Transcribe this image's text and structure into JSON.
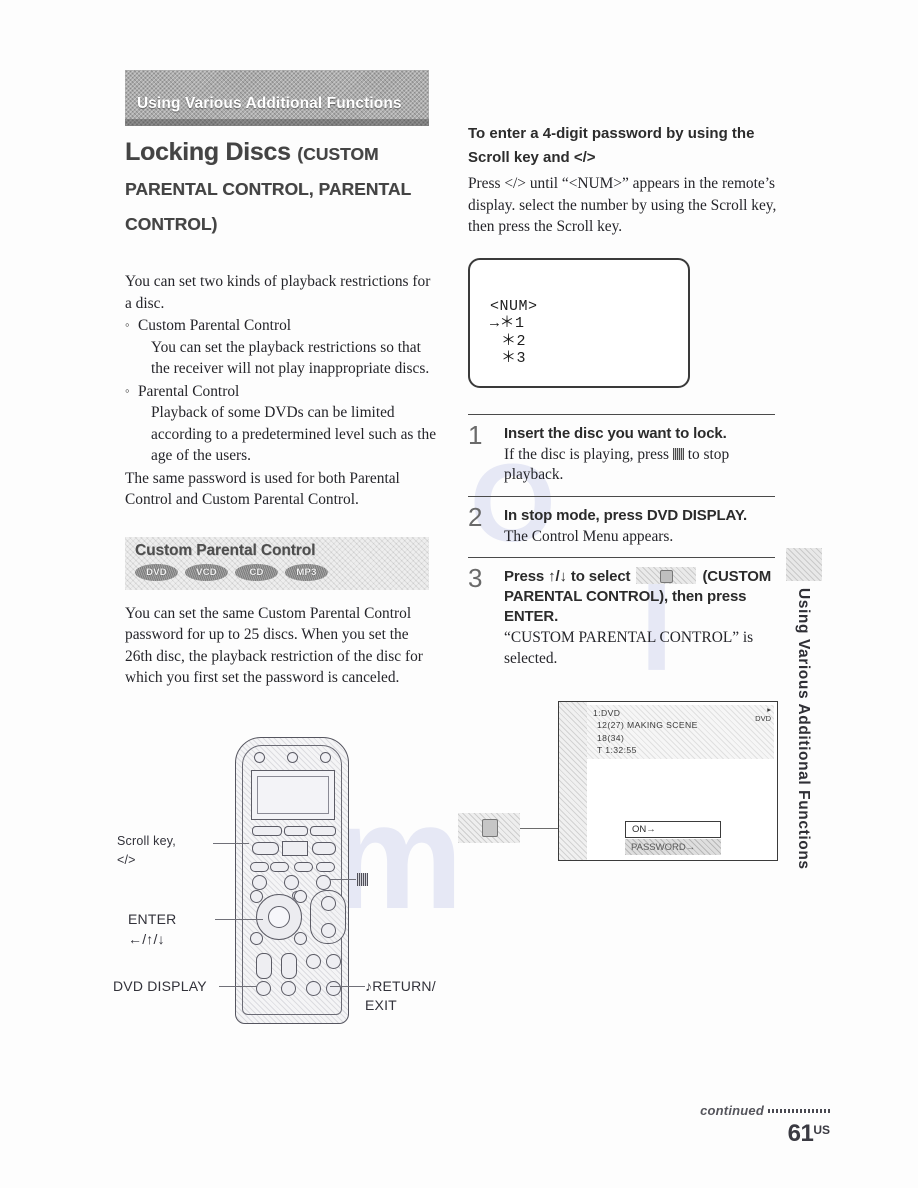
{
  "chapter": {
    "band_label": "Using Various Additional Functions"
  },
  "title": {
    "main": "Locking Discs",
    "paren": "(CUSTOM PARENTAL CONTROL, PARENTAL CONTROL)"
  },
  "left_column": {
    "intro": "You can set two kinds of playback restrictions for a disc.",
    "bullets": [
      {
        "label": "Custom Parental Control",
        "desc": "You can set the playback restrictions so that the receiver will not play inappropriate discs."
      },
      {
        "label": "Parental Control",
        "desc": "Playback of some DVDs can be limited according to a predetermined level such as the age of the users."
      }
    ],
    "closing": "The same password is used for both Parental Control and Custom Parental Control.",
    "subsection": {
      "title": "Custom Parental Control",
      "badges": [
        "DVD",
        "VCD",
        "CD",
        "MP3"
      ]
    },
    "subsection_body": "You can set the same Custom Parental Control password for up to 25 discs. When you set the 26th disc, the playback restriction of the disc for which you first set the password is canceled."
  },
  "remote_figure": {
    "labels": {
      "scroll_key": "Scroll key,",
      "scroll_key_sub": "</>",
      "enter": "ENTER",
      "enter_sub": "←/↑/↓",
      "dvd_display": "DVD DISPLAY",
      "return_exit": "♪RETURN/",
      "return_exit_sub": "EXIT"
    }
  },
  "right_column": {
    "heading": "To enter a 4-digit password by using the Scroll key and </>",
    "heading_body": "Press </> until “<NUM>” appears in the remote’s display. select the number by using the Scroll key, then press the Scroll key.",
    "display_box": {
      "line1": "<NUM>",
      "line2": "→＊1",
      "line3": "＊2",
      "line4": "＊3"
    },
    "steps": [
      {
        "num": "1",
        "title": "Insert the disc you want to lock.",
        "body_pre": "If the disc is playing, press",
        "body_post": "to stop playback."
      },
      {
        "num": "2",
        "title": "In stop mode, press DVD DISPLAY.",
        "body": "The Control Menu appears."
      },
      {
        "num": "3",
        "title_pre": "Press ↑/↓ to select",
        "title_post": "(CUSTOM PARENTAL CONTROL), then press ENTER.",
        "body": "“CUSTOM PARENTAL CONTROL” is selected."
      }
    ],
    "osd": {
      "line1": "1:DVD",
      "line2": "12(27) MAKING SCENE",
      "line3": "18(34)",
      "line4": "T  1:32:55",
      "disc_tag": "DVD",
      "option_on": "ON→",
      "option_password": "PASSWORD→"
    }
  },
  "side_tab": {
    "text": "Using Various Additional Functions"
  },
  "footer": {
    "continued": "continued",
    "page": "61",
    "region": "US"
  }
}
